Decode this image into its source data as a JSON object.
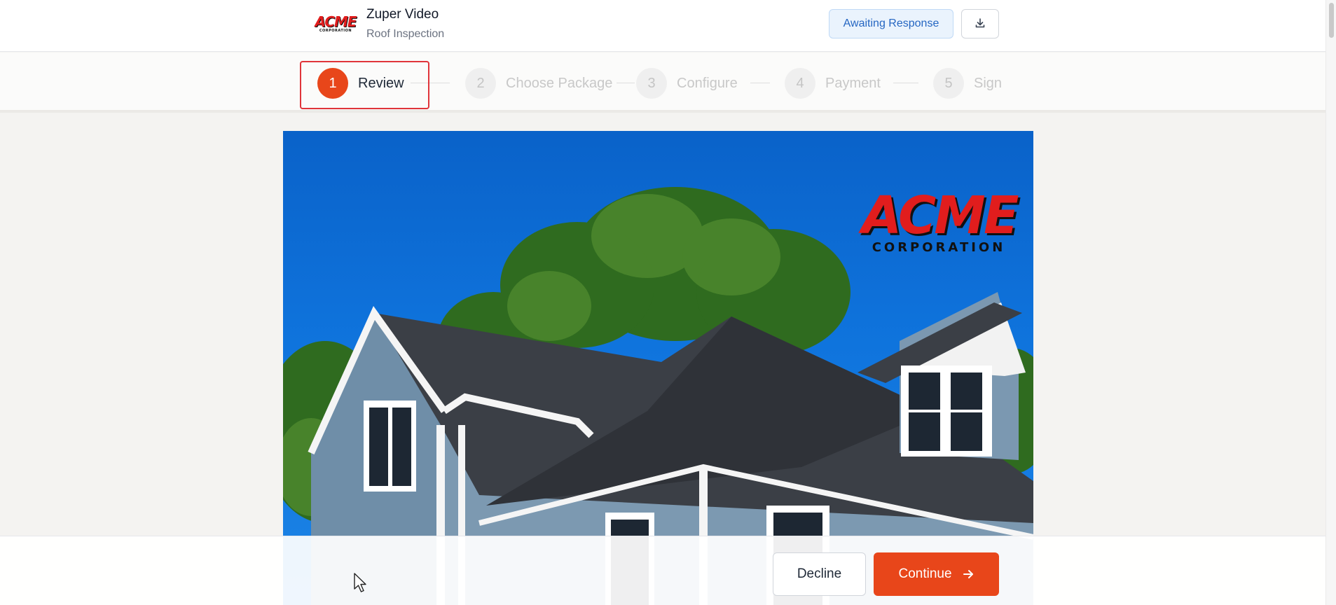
{
  "header": {
    "logo": {
      "word": "ACME",
      "sub": "CORPORATION"
    },
    "title": "Zuper Video",
    "subtitle": "Roof Inspection",
    "status": "Awaiting Response",
    "download_icon": "download-icon"
  },
  "stepper": {
    "active_step": 1,
    "steps": [
      {
        "num": "1",
        "label": "Review"
      },
      {
        "num": "2",
        "label": "Choose Package"
      },
      {
        "num": "3",
        "label": "Configure"
      },
      {
        "num": "4",
        "label": "Payment"
      },
      {
        "num": "5",
        "label": "Sign"
      }
    ]
  },
  "hero": {
    "logo": {
      "word": "ACME",
      "sub": "CORPORATION"
    }
  },
  "footer": {
    "decline_label": "Decline",
    "continue_label": "Continue",
    "continue_icon": "arrow-right-icon"
  },
  "colors": {
    "accent": "#e8461a",
    "badge_text": "#2566c2",
    "badge_bg": "#eaf3fd",
    "highlight": "#e0343a"
  }
}
